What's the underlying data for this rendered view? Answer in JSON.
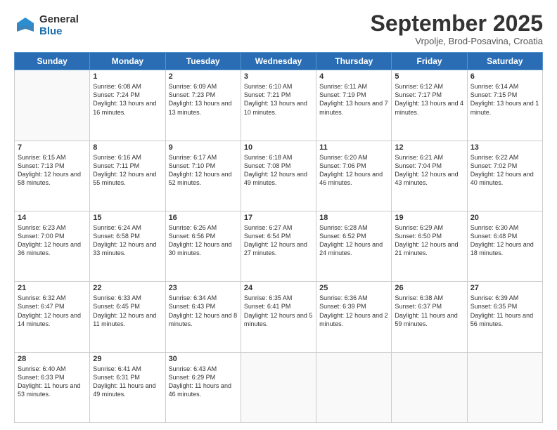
{
  "logo": {
    "general": "General",
    "blue": "Blue"
  },
  "header": {
    "month": "September 2025",
    "location": "Vrpolje, Brod-Posavina, Croatia"
  },
  "weekdays": [
    "Sunday",
    "Monday",
    "Tuesday",
    "Wednesday",
    "Thursday",
    "Friday",
    "Saturday"
  ],
  "weeks": [
    [
      {
        "day": "",
        "sunrise": "",
        "sunset": "",
        "daylight": ""
      },
      {
        "day": "1",
        "sunrise": "Sunrise: 6:08 AM",
        "sunset": "Sunset: 7:24 PM",
        "daylight": "Daylight: 13 hours and 16 minutes."
      },
      {
        "day": "2",
        "sunrise": "Sunrise: 6:09 AM",
        "sunset": "Sunset: 7:23 PM",
        "daylight": "Daylight: 13 hours and 13 minutes."
      },
      {
        "day": "3",
        "sunrise": "Sunrise: 6:10 AM",
        "sunset": "Sunset: 7:21 PM",
        "daylight": "Daylight: 13 hours and 10 minutes."
      },
      {
        "day": "4",
        "sunrise": "Sunrise: 6:11 AM",
        "sunset": "Sunset: 7:19 PM",
        "daylight": "Daylight: 13 hours and 7 minutes."
      },
      {
        "day": "5",
        "sunrise": "Sunrise: 6:12 AM",
        "sunset": "Sunset: 7:17 PM",
        "daylight": "Daylight: 13 hours and 4 minutes."
      },
      {
        "day": "6",
        "sunrise": "Sunrise: 6:14 AM",
        "sunset": "Sunset: 7:15 PM",
        "daylight": "Daylight: 13 hours and 1 minute."
      }
    ],
    [
      {
        "day": "7",
        "sunrise": "Sunrise: 6:15 AM",
        "sunset": "Sunset: 7:13 PM",
        "daylight": "Daylight: 12 hours and 58 minutes."
      },
      {
        "day": "8",
        "sunrise": "Sunrise: 6:16 AM",
        "sunset": "Sunset: 7:11 PM",
        "daylight": "Daylight: 12 hours and 55 minutes."
      },
      {
        "day": "9",
        "sunrise": "Sunrise: 6:17 AM",
        "sunset": "Sunset: 7:10 PM",
        "daylight": "Daylight: 12 hours and 52 minutes."
      },
      {
        "day": "10",
        "sunrise": "Sunrise: 6:18 AM",
        "sunset": "Sunset: 7:08 PM",
        "daylight": "Daylight: 12 hours and 49 minutes."
      },
      {
        "day": "11",
        "sunrise": "Sunrise: 6:20 AM",
        "sunset": "Sunset: 7:06 PM",
        "daylight": "Daylight: 12 hours and 46 minutes."
      },
      {
        "day": "12",
        "sunrise": "Sunrise: 6:21 AM",
        "sunset": "Sunset: 7:04 PM",
        "daylight": "Daylight: 12 hours and 43 minutes."
      },
      {
        "day": "13",
        "sunrise": "Sunrise: 6:22 AM",
        "sunset": "Sunset: 7:02 PM",
        "daylight": "Daylight: 12 hours and 40 minutes."
      }
    ],
    [
      {
        "day": "14",
        "sunrise": "Sunrise: 6:23 AM",
        "sunset": "Sunset: 7:00 PM",
        "daylight": "Daylight: 12 hours and 36 minutes."
      },
      {
        "day": "15",
        "sunrise": "Sunrise: 6:24 AM",
        "sunset": "Sunset: 6:58 PM",
        "daylight": "Daylight: 12 hours and 33 minutes."
      },
      {
        "day": "16",
        "sunrise": "Sunrise: 6:26 AM",
        "sunset": "Sunset: 6:56 PM",
        "daylight": "Daylight: 12 hours and 30 minutes."
      },
      {
        "day": "17",
        "sunrise": "Sunrise: 6:27 AM",
        "sunset": "Sunset: 6:54 PM",
        "daylight": "Daylight: 12 hours and 27 minutes."
      },
      {
        "day": "18",
        "sunrise": "Sunrise: 6:28 AM",
        "sunset": "Sunset: 6:52 PM",
        "daylight": "Daylight: 12 hours and 24 minutes."
      },
      {
        "day": "19",
        "sunrise": "Sunrise: 6:29 AM",
        "sunset": "Sunset: 6:50 PM",
        "daylight": "Daylight: 12 hours and 21 minutes."
      },
      {
        "day": "20",
        "sunrise": "Sunrise: 6:30 AM",
        "sunset": "Sunset: 6:48 PM",
        "daylight": "Daylight: 12 hours and 18 minutes."
      }
    ],
    [
      {
        "day": "21",
        "sunrise": "Sunrise: 6:32 AM",
        "sunset": "Sunset: 6:47 PM",
        "daylight": "Daylight: 12 hours and 14 minutes."
      },
      {
        "day": "22",
        "sunrise": "Sunrise: 6:33 AM",
        "sunset": "Sunset: 6:45 PM",
        "daylight": "Daylight: 12 hours and 11 minutes."
      },
      {
        "day": "23",
        "sunrise": "Sunrise: 6:34 AM",
        "sunset": "Sunset: 6:43 PM",
        "daylight": "Daylight: 12 hours and 8 minutes."
      },
      {
        "day": "24",
        "sunrise": "Sunrise: 6:35 AM",
        "sunset": "Sunset: 6:41 PM",
        "daylight": "Daylight: 12 hours and 5 minutes."
      },
      {
        "day": "25",
        "sunrise": "Sunrise: 6:36 AM",
        "sunset": "Sunset: 6:39 PM",
        "daylight": "Daylight: 12 hours and 2 minutes."
      },
      {
        "day": "26",
        "sunrise": "Sunrise: 6:38 AM",
        "sunset": "Sunset: 6:37 PM",
        "daylight": "Daylight: 11 hours and 59 minutes."
      },
      {
        "day": "27",
        "sunrise": "Sunrise: 6:39 AM",
        "sunset": "Sunset: 6:35 PM",
        "daylight": "Daylight: 11 hours and 56 minutes."
      }
    ],
    [
      {
        "day": "28",
        "sunrise": "Sunrise: 6:40 AM",
        "sunset": "Sunset: 6:33 PM",
        "daylight": "Daylight: 11 hours and 53 minutes."
      },
      {
        "day": "29",
        "sunrise": "Sunrise: 6:41 AM",
        "sunset": "Sunset: 6:31 PM",
        "daylight": "Daylight: 11 hours and 49 minutes."
      },
      {
        "day": "30",
        "sunrise": "Sunrise: 6:43 AM",
        "sunset": "Sunset: 6:29 PM",
        "daylight": "Daylight: 11 hours and 46 minutes."
      },
      {
        "day": "",
        "sunrise": "",
        "sunset": "",
        "daylight": ""
      },
      {
        "day": "",
        "sunrise": "",
        "sunset": "",
        "daylight": ""
      },
      {
        "day": "",
        "sunrise": "",
        "sunset": "",
        "daylight": ""
      },
      {
        "day": "",
        "sunrise": "",
        "sunset": "",
        "daylight": ""
      }
    ]
  ]
}
